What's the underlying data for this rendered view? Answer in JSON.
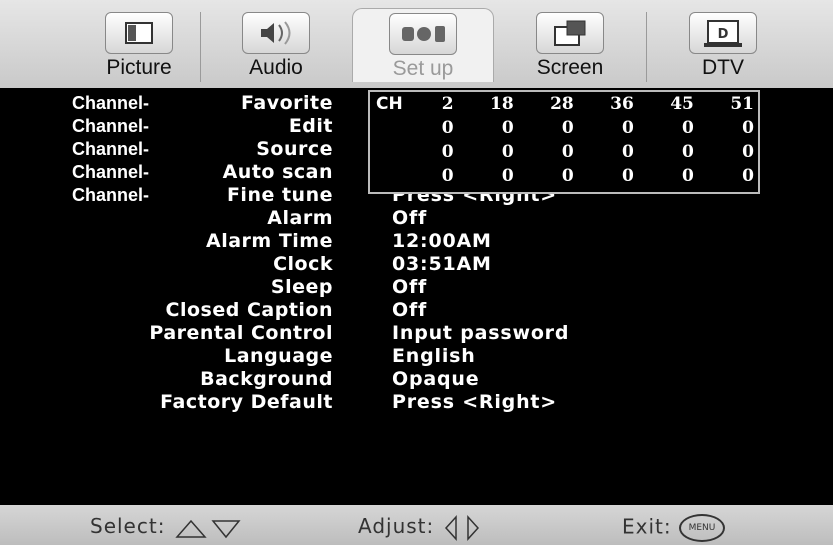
{
  "tabs": [
    {
      "label": "Picture",
      "icon": "monitor-icon"
    },
    {
      "label": "Audio",
      "icon": "speaker-icon"
    },
    {
      "label": "Set up",
      "icon": "setup-icon",
      "active": true
    },
    {
      "label": "Screen",
      "icon": "screen-icon"
    },
    {
      "label": "DTV",
      "icon": "dtv-icon"
    }
  ],
  "menu": {
    "channel_prefix": "Channel-",
    "items": [
      {
        "label": "Favorite",
        "value": ""
      },
      {
        "label": "Edit",
        "value": ""
      },
      {
        "label": "Source",
        "value": ""
      },
      {
        "label": "Auto scan",
        "value": ""
      },
      {
        "label": "Fine tune",
        "value": "Press <Right>"
      },
      {
        "label": "Alarm",
        "value": "Off"
      },
      {
        "label": "Alarm Time",
        "value": "12:00AM"
      },
      {
        "label": "Clock",
        "value": "03:51AM"
      },
      {
        "label": "Sleep",
        "value": "Off"
      },
      {
        "label": "Closed Caption",
        "value": "Off"
      },
      {
        "label": "Parental Control",
        "value": "Input password"
      },
      {
        "label": "Language",
        "value": "English"
      },
      {
        "label": "Background",
        "value": "Opaque"
      },
      {
        "label": "Factory Default",
        "value": "Press <Right>"
      }
    ]
  },
  "favorite_table": {
    "header": "CH",
    "rows": [
      [
        "2",
        "18",
        "28",
        "36",
        "45",
        "51"
      ],
      [
        "0",
        "0",
        "0",
        "0",
        "0",
        "0"
      ],
      [
        "0",
        "0",
        "0",
        "0",
        "0",
        "0"
      ],
      [
        "0",
        "0",
        "0",
        "0",
        "0",
        "0"
      ]
    ]
  },
  "footer": {
    "select": "Select:",
    "adjust": "Adjust:",
    "exit": "Exit:",
    "menu_button": "MENU"
  }
}
